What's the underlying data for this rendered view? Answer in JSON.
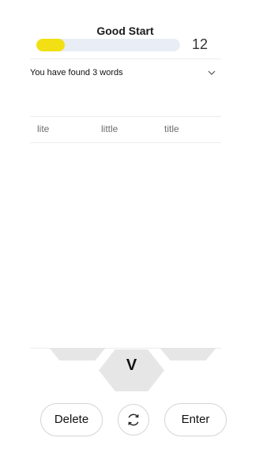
{
  "header": {
    "rank": "Good Start",
    "score": "12",
    "progress_fraction": 0.2
  },
  "found_words": {
    "summary": "You have found 3 words",
    "words": [
      "lite",
      "little",
      "title"
    ]
  },
  "hive": {
    "center_letter": "V"
  },
  "controls": {
    "delete_label": "Delete",
    "enter_label": "Enter"
  },
  "icons": {
    "expand": "chevron-down-icon",
    "shuffle": "shuffle-icon"
  },
  "colors": {
    "progress_fill": "#f2e014",
    "progress_track": "#e9edf5",
    "hex_fill": "#e6e6e6"
  }
}
